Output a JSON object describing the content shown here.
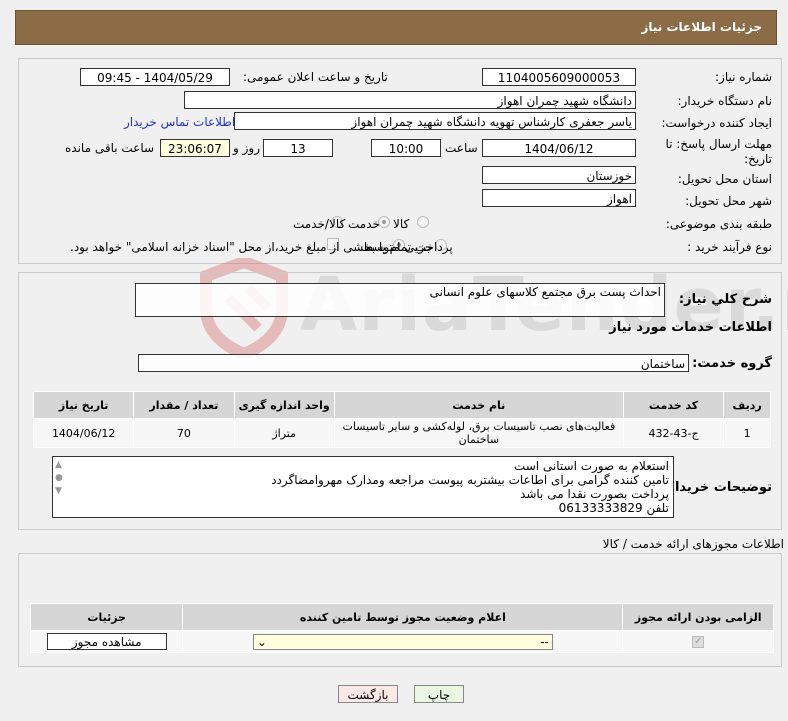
{
  "header": {
    "title": "جزئیات اطلاعات نیاز"
  },
  "details": {
    "need_number_label": "شماره نیاز:",
    "need_number": "1104005609000053",
    "announce_label": "تاریخ و ساعت اعلان عمومی:",
    "announce_value": "1404/05/29 - 09:45",
    "buyer_org_label": "نام دستگاه خریدار:",
    "buyer_org": "دانشگاه شهید چمران اهواز",
    "requester_label": "ایجاد کننده درخواست:",
    "requester": "یاسر جعفری کارشناس تهویه دانشگاه شهید چمران اهواز",
    "contact_link": "اطلاعات تماس خریدار",
    "deadline_label": "مهلت ارسال پاسخ: تا تاریخ:",
    "deadline_date": "1404/06/12",
    "time_label": "ساعت",
    "deadline_time": "10:00",
    "days": "13",
    "days_label": "روز و",
    "remaining": "23:06:07",
    "remaining_label": "ساعت باقی مانده",
    "province_label": "استان محل تحویل:",
    "province": "خوزستان",
    "city_label": "شهر محل تحویل:",
    "city": "اهواز",
    "category_label": "طبقه بندی موضوعی:",
    "category_options": [
      "کالا",
      "خدمت",
      "کالا/خدمت"
    ],
    "category_selected": "خدمت",
    "process_label": "نوع فرآیند خرید :",
    "process_options": [
      "جزیی",
      "متوسط"
    ],
    "process_selected": "متوسط",
    "payment_note": "پرداخت تمام یا بخشی از مبلغ خرید،از محل \"اسناد خزانه اسلامی\" خواهد بود."
  },
  "services": {
    "summary_label": "شرح کلي نياز:",
    "summary": "احداث پست برق مجتمع کلاسهای علوم انسانی",
    "section_title": "اطلاعات خدمات مورد نیاز",
    "group_label": "گروه خدمت:",
    "group": "ساختمان",
    "columns": [
      "ردیف",
      "کد خدمت",
      "نام خدمت",
      "واحد اندازه گیری",
      "تعداد / مقدار",
      "تاریخ نیاز"
    ],
    "rows": [
      [
        "1",
        "ج-43-432",
        "فعالیت‌های نصب تاسیسات برق، لوله‌کشی و سایر تاسیسات ساختمان",
        "متراژ",
        "70",
        "1404/06/12"
      ]
    ],
    "buyer_notes_label": "توضیحات خریدار:",
    "buyer_notes": [
      "استعلام به صورت استانی است",
      "تامین کننده گرامی برای اطاعات بیشتربه پیوست مراجعه ومدارک مهروامضاگردد",
      "پرداخت بصورت نقدا می باشد",
      "تلفن 06133333829"
    ]
  },
  "permits": {
    "title": "اطلاعات مجوزهای ارائه خدمت / کالا",
    "columns": [
      "الزامی بودن ارائه مجوز",
      "اعلام وضعیت مجوز توسط تامین کننده",
      "جزئیات"
    ],
    "select_value": "--",
    "view_button": "مشاهده مجوز"
  },
  "footer": {
    "print": "چاپ",
    "back": "بازگشت"
  },
  "watermark": "AriaTender.neT"
}
